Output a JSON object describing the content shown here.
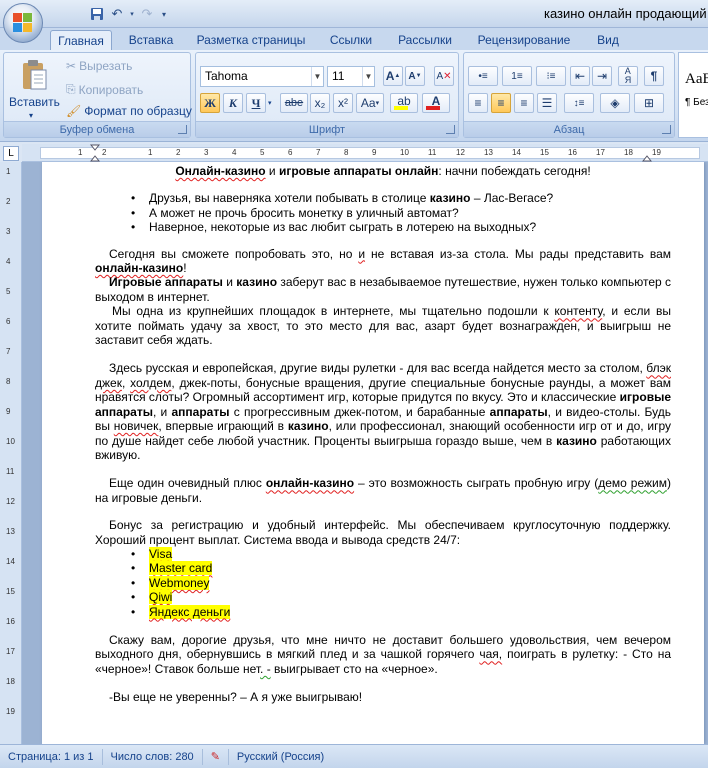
{
  "window": {
    "title": "казино онлайн продающий те"
  },
  "tabs": [
    "Главная",
    "Вставка",
    "Разметка страницы",
    "Ссылки",
    "Рассылки",
    "Рецензирование",
    "Вид"
  ],
  "clipboard": {
    "paste": "Вставить",
    "cut": "Вырезать",
    "copy": "Копировать",
    "format_painter": "Формат по образцу",
    "label": "Буфер обмена"
  },
  "font": {
    "family": "Tahoma",
    "size": "11",
    "label": "Шрифт",
    "bold": "Ж",
    "italic": "К",
    "underline": "Ч",
    "strike": "abe",
    "sub": "x₂",
    "sup": "x²",
    "case": "Aa",
    "grow": "A",
    "shrink": "A"
  },
  "paragraph": {
    "label": "Абзац"
  },
  "styles": {
    "preview": "AaB",
    "sub": "¶ Без"
  },
  "ruler": {
    "h_numbers": [
      "1",
      "2",
      "1",
      "2",
      "3",
      "4",
      "5",
      "6",
      "7",
      "8",
      "9",
      "10",
      "11",
      "12",
      "13",
      "14",
      "15",
      "16",
      "17",
      "18",
      "19"
    ],
    "v_numbers": [
      "1",
      "2",
      "3",
      "4",
      "5",
      "6",
      "7",
      "8",
      "9",
      "10",
      "11",
      "12",
      "13",
      "14",
      "15",
      "16",
      "17",
      "18",
      "19"
    ]
  },
  "doc": {
    "heading": {
      "a": "Онлайн-казино",
      "b": " и ",
      "c": "игровые аппараты онлайн",
      "d": ": начни побеждать сегодня!"
    },
    "bullets1": [
      {
        "a": "Друзья, вы  наверняка хотели побывать в столице ",
        "b": "казино",
        "c": " – Лас-Вегасе?"
      },
      {
        "a": "А может не прочь бросить монетку в уличный автомат?"
      },
      {
        "a": "Наверное, некоторые из вас любит сыграть в лотерею на выходных?"
      }
    ],
    "p1": {
      "a": "Сегодня вы сможете попробовать это, но ",
      "b": "и",
      "c": " не вставая  из-за стола. Мы рады представить вам ",
      "d": "онлайн-казино",
      "e": "!"
    },
    "p2": {
      "a": "Игровые аппараты",
      "b": " и ",
      "c": "казино",
      "d": " заберут вас в незабываемое путешествие, нужен только компьютер с выходом в интернет."
    },
    "p3": {
      "a": "Мы одна из крупнейших площадок  в интернете, мы тщательно подошли к ",
      "b": "контенту",
      "c": ", и если вы хотите поймать удачу за хвост, то это место для вас, азарт будет вознагражден, и выигрыш не заставит себя ждать."
    },
    "p4": {
      "a": "Здесь русская и европейская, другие виды рулетки - для вас всегда найдется место за столом, ",
      "b": "блэк джек",
      "c": ", ",
      "d": "холдем",
      "e": ", джек-поты, бонусные вращения, другие специальные бонусные раунды, а может вам нравятся слоты? Огромный ассортимент игр, которые придутся по вкусу. Это и классические ",
      "f": "игровые аппараты",
      "g": ", и ",
      "h": "аппараты",
      "i": " с прогрессивным джек-потом, и барабанные ",
      "j": "аппараты",
      "k": ", и видео-столы. Будь вы ",
      "l": "новичек",
      "m": ", впервые играющий в ",
      "n": "казино",
      "o": ", или профессионал, знающий особенности игр от и до, игру по душе найдет себе любой участник. Проценты выигрыша гораздо выше, чем в ",
      "p": "казино",
      "q": " работающих вживую."
    },
    "p5": {
      "a": "Еще один очевидный плюс ",
      "b": "онлайн-казино",
      "c": " – это возможность сыграть пробную игру (",
      "d": "демо режим",
      "e": ") на игровые деньги."
    },
    "p6": {
      "a": "Бонус за регистрацию и удобный интерфейс. Мы обеспечиваем круглосуточную поддержку. Хороший процент выплат. Система ввода и вывода средств 24/7:"
    },
    "bullets2": [
      "Visa",
      "Master card",
      "Webmoney",
      "Qiwi",
      "Яндекс деньги"
    ],
    "p7": {
      "a": "Скажу вам, дорогие друзья, что мне ничто не доставит большего удовольствия, чем вечером выходного дня, обернувшись в мягкий плед и за чашкой горячего ",
      "b": "чая,",
      "c": " поиграть в рулетку: - Сто на «черное»! Ставок больше нет",
      "d": ". -",
      "e": " выигрывает сто на «черное»."
    },
    "p8": {
      "a": "-Вы еще не уверенны? – А я уже выигрываю!"
    }
  },
  "status": {
    "page": "Страница: 1 из 1",
    "words": "Число слов: 280",
    "lang": "Русский (Россия)"
  },
  "colors": {
    "highlight": "#ffff00",
    "font_color_bar": "#e02020",
    "highlight_bar": "#ffff00"
  }
}
